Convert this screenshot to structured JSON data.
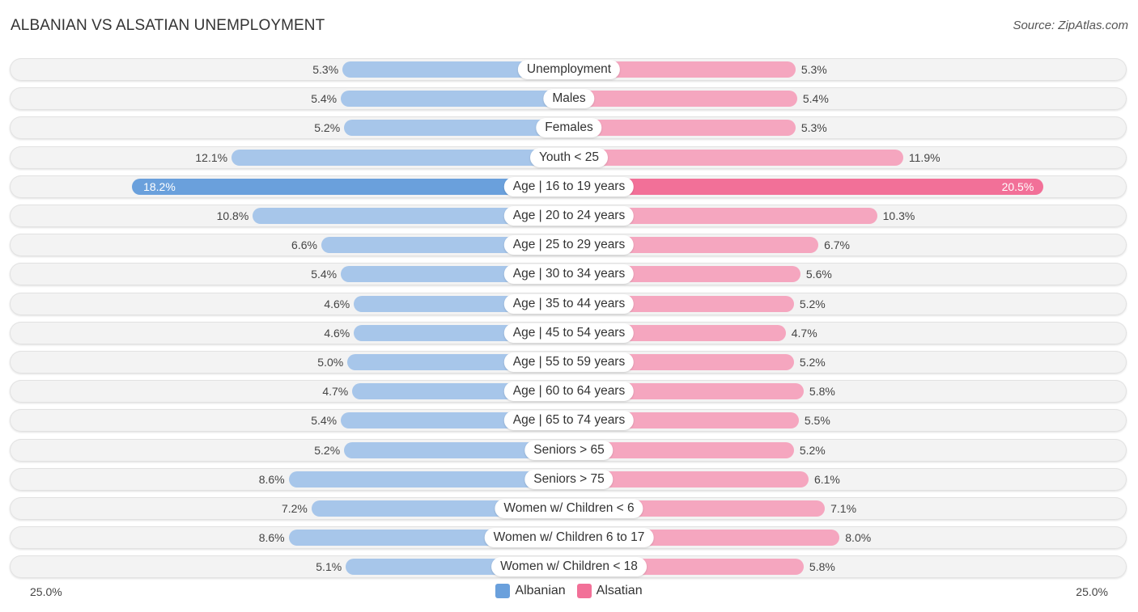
{
  "title": "ALBANIAN VS ALSATIAN UNEMPLOYMENT",
  "source": "Source: ZipAtlas.com",
  "colors": {
    "albanian": "#a7c6ea",
    "albanian_highlight": "#6aa0dc",
    "alsatian": "#f5a6bf",
    "alsatian_highlight": "#f27098"
  },
  "chart_data": {
    "type": "bar",
    "orientation": "horizontal-diverging",
    "title": "ALBANIAN VS ALSATIAN UNEMPLOYMENT",
    "xlabel": "",
    "ylabel": "",
    "axis_min_label": "25.0%",
    "axis_max_label": "25.0%",
    "xlim": [
      0,
      25
    ],
    "legend_position": "bottom",
    "categories": [
      "Unemployment",
      "Males",
      "Females",
      "Youth < 25",
      "Age | 16 to 19 years",
      "Age | 20 to 24 years",
      "Age | 25 to 29 years",
      "Age | 30 to 34 years",
      "Age | 35 to 44 years",
      "Age | 45 to 54 years",
      "Age | 55 to 59 years",
      "Age | 60 to 64 years",
      "Age | 65 to 74 years",
      "Seniors > 65",
      "Seniors > 75",
      "Women w/ Children < 6",
      "Women w/ Children 6 to 17",
      "Women w/ Children < 18"
    ],
    "series": [
      {
        "name": "Albanian",
        "side": "left",
        "values": [
          5.3,
          5.4,
          5.2,
          12.1,
          18.2,
          10.8,
          6.6,
          5.4,
          4.6,
          4.6,
          5.0,
          4.7,
          5.4,
          5.2,
          8.6,
          7.2,
          8.6,
          5.1
        ],
        "labels": [
          "5.3%",
          "5.4%",
          "5.2%",
          "12.1%",
          "18.2%",
          "10.8%",
          "6.6%",
          "5.4%",
          "4.6%",
          "4.6%",
          "5.0%",
          "4.7%",
          "5.4%",
          "5.2%",
          "8.6%",
          "7.2%",
          "8.6%",
          "5.1%"
        ]
      },
      {
        "name": "Alsatian",
        "side": "right",
        "values": [
          5.3,
          5.4,
          5.3,
          11.9,
          20.5,
          10.3,
          6.7,
          5.6,
          5.2,
          4.7,
          5.2,
          5.8,
          5.5,
          5.2,
          6.1,
          7.1,
          8.0,
          5.8
        ],
        "labels": [
          "5.3%",
          "5.4%",
          "5.3%",
          "11.9%",
          "20.5%",
          "10.3%",
          "6.7%",
          "5.6%",
          "5.2%",
          "4.7%",
          "5.2%",
          "5.8%",
          "5.5%",
          "5.2%",
          "6.1%",
          "7.1%",
          "8.0%",
          "5.8%"
        ]
      }
    ],
    "highlighted_category": "Age | 16 to 19 years"
  },
  "legend": {
    "albanian": "Albanian",
    "alsatian": "Alsatian"
  }
}
